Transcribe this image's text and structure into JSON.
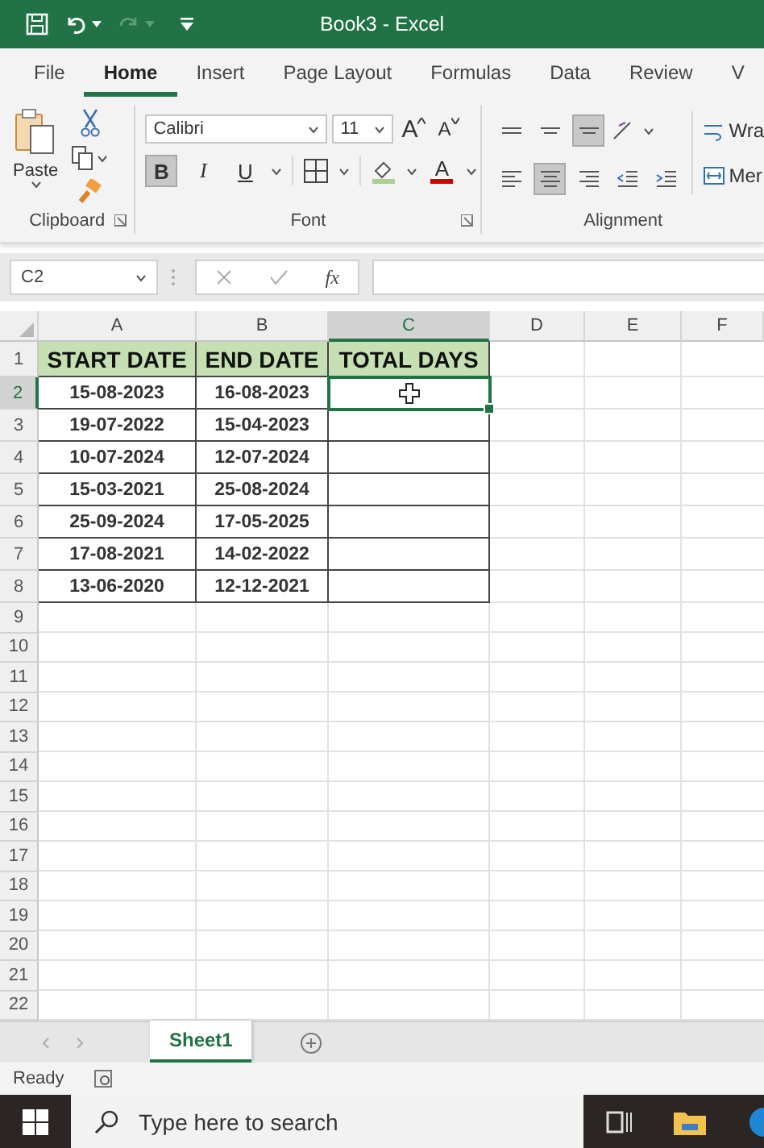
{
  "title_bar": {
    "title": "Book3  -  Excel"
  },
  "ribbon_tabs": [
    {
      "label": "File",
      "selected": false
    },
    {
      "label": "Home",
      "selected": true
    },
    {
      "label": "Insert",
      "selected": false
    },
    {
      "label": "Page Layout",
      "selected": false
    },
    {
      "label": "Formulas",
      "selected": false
    },
    {
      "label": "Data",
      "selected": false
    },
    {
      "label": "Review",
      "selected": false
    },
    {
      "label": "V",
      "selected": false
    }
  ],
  "ribbon": {
    "paste_label": "Paste",
    "font_name": "Calibri",
    "font_size": "11",
    "grow_font": "A",
    "shrink_font": "A",
    "font_color": "A",
    "font_buttons": [
      {
        "kind": "bold",
        "label": "B",
        "pressed": true
      },
      {
        "kind": "italic",
        "label": "I",
        "pressed": false
      },
      {
        "kind": "underline",
        "label": "U",
        "pressed": false
      }
    ],
    "align_top_row": [
      {
        "kind": "top",
        "pressed": false
      },
      {
        "kind": "middle",
        "pressed": false
      },
      {
        "kind": "bottom",
        "pressed": true
      }
    ],
    "align_bottom_row": [
      {
        "kind": "left",
        "pressed": false
      },
      {
        "kind": "center",
        "pressed": true
      },
      {
        "kind": "right",
        "pressed": false
      },
      {
        "kind": "outdent",
        "pressed": false
      },
      {
        "kind": "indent",
        "pressed": false
      }
    ],
    "wrap_label": "Wra",
    "merge_label": "Mer",
    "groups": [
      "Clipboard",
      "Font",
      "Alignment"
    ]
  },
  "formula_bar": {
    "name_box": "C2",
    "function_label": "fx"
  },
  "columns": [
    {
      "label": "A",
      "selected": false
    },
    {
      "label": "B",
      "selected": false
    },
    {
      "label": "C",
      "selected": true
    },
    {
      "label": "D",
      "selected": false
    },
    {
      "label": "E",
      "selected": false
    },
    {
      "label": "F",
      "selected": false
    }
  ],
  "rows": [
    {
      "label": "1",
      "selected": false,
      "cells": [
        {
          "kind": "header",
          "text": "START DATE"
        },
        {
          "kind": "header",
          "text": "END DATE"
        },
        {
          "kind": "header",
          "text": "TOTAL DAYS"
        }
      ]
    },
    {
      "label": "2",
      "selected": true,
      "cells": [
        {
          "kind": "value",
          "text": "15-08-2023"
        },
        {
          "kind": "value",
          "text": "16-08-2023"
        },
        {
          "kind": "blank"
        }
      ]
    },
    {
      "label": "3",
      "selected": false,
      "cells": [
        {
          "kind": "value",
          "text": "19-07-2022"
        },
        {
          "kind": "value",
          "text": "15-04-2023"
        },
        {
          "kind": "blank"
        }
      ]
    },
    {
      "label": "4",
      "selected": false,
      "cells": [
        {
          "kind": "value",
          "text": "10-07-2024"
        },
        {
          "kind": "value",
          "text": "12-07-2024"
        },
        {
          "kind": "blank"
        }
      ]
    },
    {
      "label": "5",
      "selected": false,
      "cells": [
        {
          "kind": "value",
          "text": "15-03-2021"
        },
        {
          "kind": "value",
          "text": "25-08-2024"
        },
        {
          "kind": "blank"
        }
      ]
    },
    {
      "label": "6",
      "selected": false,
      "cells": [
        {
          "kind": "value",
          "text": "25-09-2024"
        },
        {
          "kind": "value",
          "text": "17-05-2025"
        },
        {
          "kind": "blank"
        }
      ]
    },
    {
      "label": "7",
      "selected": false,
      "cells": [
        {
          "kind": "value",
          "text": "17-08-2021"
        },
        {
          "kind": "value",
          "text": "14-02-2022"
        },
        {
          "kind": "blank"
        }
      ]
    },
    {
      "label": "8",
      "selected": false,
      "cells": [
        {
          "kind": "value",
          "text": "13-06-2020"
        },
        {
          "kind": "value",
          "text": "12-12-2021"
        },
        {
          "kind": "blank"
        }
      ]
    },
    {
      "label": "9",
      "selected": false
    },
    {
      "label": "10",
      "selected": false
    },
    {
      "label": "11",
      "selected": false
    },
    {
      "label": "12",
      "selected": false
    },
    {
      "label": "13",
      "selected": false
    },
    {
      "label": "14",
      "selected": false
    },
    {
      "label": "15",
      "selected": false
    },
    {
      "label": "16",
      "selected": false
    },
    {
      "label": "17",
      "selected": false
    },
    {
      "label": "18",
      "selected": false
    },
    {
      "label": "19",
      "selected": false
    },
    {
      "label": "20",
      "selected": false
    },
    {
      "label": "21",
      "selected": false
    },
    {
      "label": "22",
      "selected": false
    }
  ],
  "sheet_tabs": [
    {
      "label": "Sheet1",
      "selected": true
    }
  ],
  "status_bar": {
    "text": "Ready"
  },
  "taskbar": {
    "search_placeholder": "Type here to search"
  }
}
